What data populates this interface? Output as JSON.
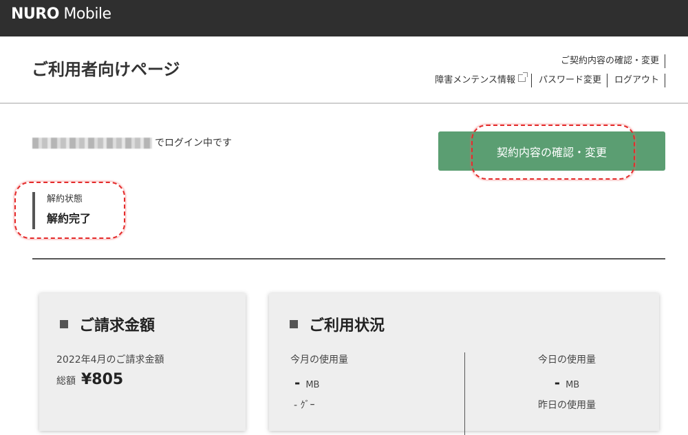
{
  "brand": {
    "logo_bold": "NURO",
    "logo_regular": " Mobile"
  },
  "header": {
    "title": "ご利用者向けページ",
    "links_row1": [
      "ご契約内容の確認・変更"
    ],
    "links_row2": [
      "障害メンテンス情報",
      "パスワード変更",
      "ログアウト"
    ]
  },
  "login": {
    "suffix": "でログイン中です"
  },
  "contract_button": {
    "label": "契約内容の確認・変更"
  },
  "status": {
    "label": "解約状態",
    "value": "解約完了"
  },
  "billing": {
    "title": "ご請求金額",
    "period_label": "2022年4月のご請求金額",
    "total_label": "総額",
    "total_value": "¥805"
  },
  "usage": {
    "title": "ご利用状況",
    "month_label": "今月の使用量",
    "month_value": "-",
    "today_label": "今日の使用量",
    "today_value": "-",
    "unit": "MB",
    "yesterday_label": "昨日の使用量",
    "partial_left": "-   ｸﾞｰ"
  },
  "colors": {
    "topbar": "#2f2f2f",
    "button": "#5b9e72",
    "annotation": "#e42b2b"
  },
  "icons": [
    "external-link-icon",
    "square-bullet-icon"
  ]
}
